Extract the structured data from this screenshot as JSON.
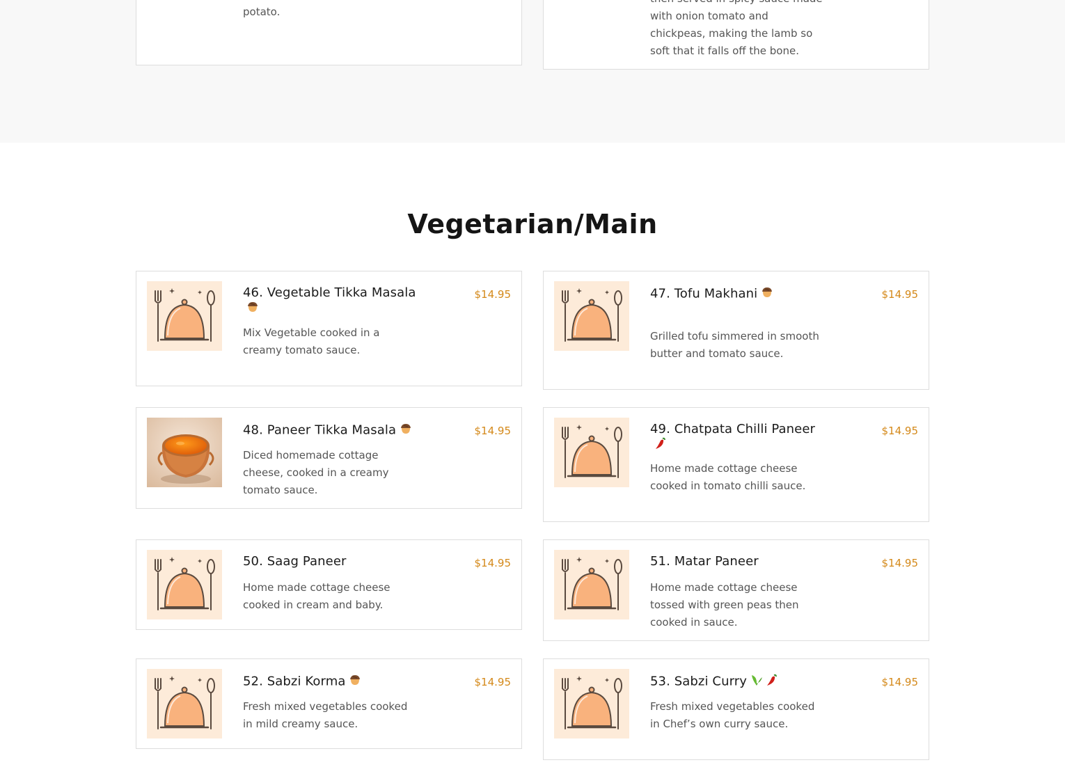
{
  "colors": {
    "price": "#d4891a",
    "thumb_bg": "#fdebd9",
    "band": "#f8f8f8"
  },
  "previous_section": {
    "left_card": {
      "desc_tail": "potato."
    },
    "right_card": {
      "desc_lines": [
        "then served in spicy sauce made",
        "with onion tomato and",
        "chickpeas, making the lamb so",
        "soft that it falls off the bone."
      ]
    }
  },
  "section": {
    "title": "Vegetarian/Main"
  },
  "items": [
    {
      "name": "46. Vegetable Tikka Masala",
      "price": "$14.95",
      "desc": "Mix Vegetable cooked in a creamy tomato sauce.",
      "tags": [
        "nut-icon"
      ],
      "image": "placeholder-dish-icon"
    },
    {
      "name": "47. Tofu Makhani",
      "price": "$14.95",
      "desc": "Grilled tofu simmered in smooth butter and tomato sauce.",
      "tags": [
        "nut-icon"
      ],
      "image": "placeholder-dish-icon"
    },
    {
      "name": "48. Paneer Tikka Masala",
      "price": "$14.95",
      "desc": "Diced homemade cottage cheese, cooked in a creamy tomato sauce.",
      "tags": [
        "nut-icon"
      ],
      "image": "curry-bowl-photo"
    },
    {
      "name": "49. Chatpata Chilli Paneer",
      "price": "$14.95",
      "desc": "Home made cottage cheese cooked in tomato chilli sauce.",
      "tags": [
        "chili-icon"
      ],
      "image": "placeholder-dish-icon"
    },
    {
      "name": "50. Saag Paneer",
      "price": "$14.95",
      "desc": "Home made cottage cheese cooked in cream and baby.",
      "tags": [],
      "image": "placeholder-dish-icon"
    },
    {
      "name": "51. Matar Paneer",
      "price": "$14.95",
      "desc": "Home made cottage cheese tossed with green peas then cooked in sauce.",
      "tags": [],
      "image": "placeholder-dish-icon"
    },
    {
      "name": "52. Sabzi Korma",
      "price": "$14.95",
      "desc": "Fresh mixed vegetables cooked in mild creamy sauce.",
      "tags": [
        "nut-icon"
      ],
      "image": "placeholder-dish-icon"
    },
    {
      "name": "53. Sabzi Curry",
      "price": "$14.95",
      "desc": "Fresh mixed vegetables cooked in Chef’s own curry sauce.",
      "tags": [
        "vegan-icon",
        "chili-icon"
      ],
      "image": "placeholder-dish-icon"
    }
  ]
}
